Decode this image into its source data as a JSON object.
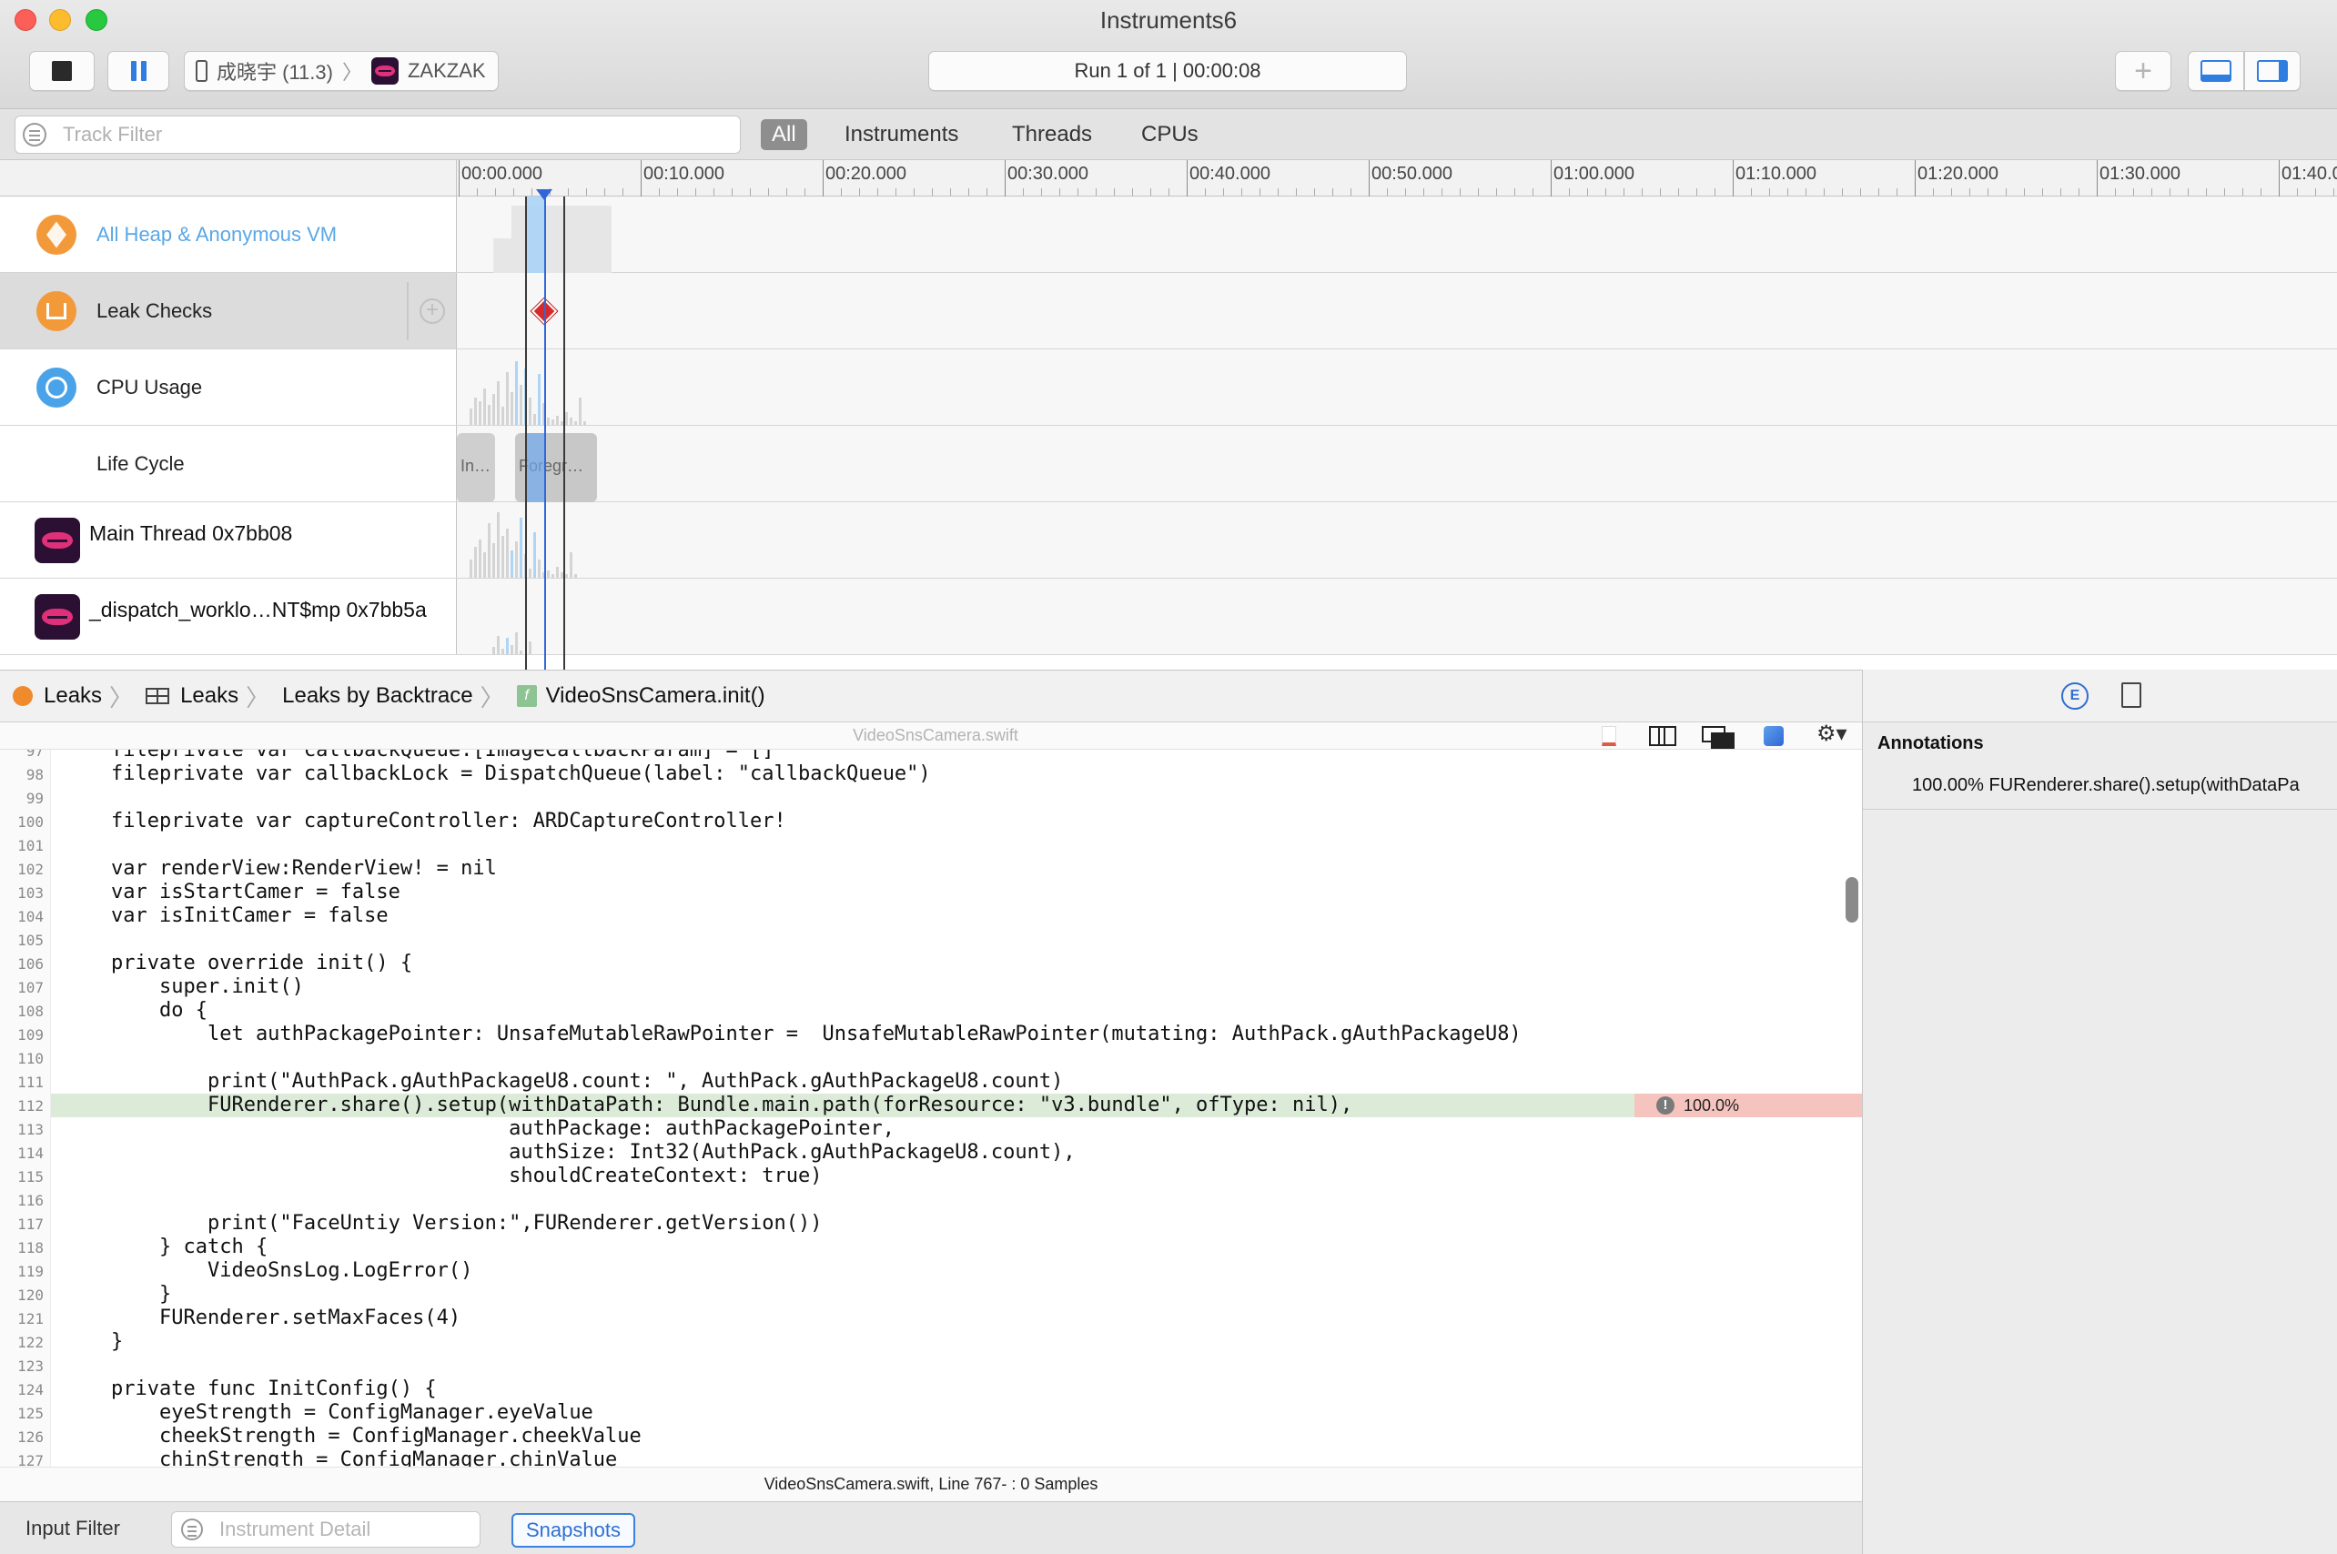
{
  "window": {
    "title": "Instruments6"
  },
  "toolbar": {
    "device_name": "成晓宇 (11.3)",
    "app_name": "ZAKZAK",
    "run_status": "Run 1 of 1  |  00:00:08",
    "add_icon": "plus-icon"
  },
  "filter": {
    "placeholder": "Track Filter",
    "scopes": [
      "All",
      "Instruments",
      "Threads",
      "CPUs"
    ],
    "active_scope": "All"
  },
  "ruler": {
    "ticks": [
      "00:00.000",
      "00:10.000",
      "00:20.000",
      "00:30.000",
      "00:40.000",
      "00:50.000",
      "01:00.000",
      "01:10.000",
      "01:20.000",
      "01:30.000",
      "01:40.0"
    ]
  },
  "tracks": [
    {
      "label": "All Heap & Anonymous VM",
      "icon": "heap-cube-icon",
      "color": "#f29a3a"
    },
    {
      "label": "Leak Checks",
      "icon": "leak-pipe-icon",
      "color": "#f29a3a"
    },
    {
      "label": "CPU Usage",
      "icon": "cpu-ring-icon",
      "color": "#4aa3e8"
    },
    {
      "label": "Life Cycle"
    },
    {
      "label": "Main Thread  0x7bb08",
      "icon": "app-thread-icon"
    },
    {
      "label": "_dispatch_worklo…NT$mp  0x7bb5a",
      "icon": "app-thread-icon"
    }
  ],
  "lifecycle": {
    "seg1": "In…",
    "seg2": "Foregr…"
  },
  "breadcrumb": {
    "items": [
      "Leaks",
      "Leaks",
      "Leaks by Backtrace",
      "VideoSnsCamera.init()"
    ]
  },
  "source": {
    "filename": "VideoSnsCamera.swift",
    "status": "VideoSnsCamera.swift, Line 767- : 0 Samples",
    "hot_line": "112",
    "hot_percent": "100.0%",
    "lines": [
      {
        "n": "97",
        "t": "fileprivate var callbackQueue:[ImageCallbackParam] = []"
      },
      {
        "n": "98",
        "t": "fileprivate var callbackLock = DispatchQueue(label: \"callbackQueue\")"
      },
      {
        "n": "99",
        "t": ""
      },
      {
        "n": "100",
        "t": "fileprivate var captureController: ARDCaptureController!"
      },
      {
        "n": "101",
        "t": ""
      },
      {
        "n": "102",
        "t": "var renderView:RenderView! = nil"
      },
      {
        "n": "103",
        "t": "var isStartCamer = false"
      },
      {
        "n": "104",
        "t": "var isInitCamer = false"
      },
      {
        "n": "105",
        "t": ""
      },
      {
        "n": "106",
        "t": "private override init() {"
      },
      {
        "n": "107",
        "t": "    super.init()"
      },
      {
        "n": "108",
        "t": "    do {"
      },
      {
        "n": "109",
        "t": "        let authPackagePointer: UnsafeMutableRawPointer =  UnsafeMutableRawPointer(mutating: AuthPack.gAuthPackageU8)"
      },
      {
        "n": "110",
        "t": ""
      },
      {
        "n": "111",
        "t": "        print(\"AuthPack.gAuthPackageU8.count: \", AuthPack.gAuthPackageU8.count)"
      },
      {
        "n": "112",
        "t": "        FURenderer.share().setup(withDataPath: Bundle.main.path(forResource: \"v3.bundle\", ofType: nil),"
      },
      {
        "n": "113",
        "t": "                                 authPackage: authPackagePointer,"
      },
      {
        "n": "114",
        "t": "                                 authSize: Int32(AuthPack.gAuthPackageU8.count),"
      },
      {
        "n": "115",
        "t": "                                 shouldCreateContext: true)"
      },
      {
        "n": "116",
        "t": ""
      },
      {
        "n": "117",
        "t": "        print(\"FaceUntiy Version:\",FURenderer.getVersion())"
      },
      {
        "n": "118",
        "t": "    } catch {"
      },
      {
        "n": "119",
        "t": "        VideoSnsLog.LogError()"
      },
      {
        "n": "120",
        "t": "    }"
      },
      {
        "n": "121",
        "t": "    FURenderer.setMaxFaces(4)"
      },
      {
        "n": "122",
        "t": "}"
      },
      {
        "n": "123",
        "t": ""
      },
      {
        "n": "124",
        "t": "private func InitConfig() {"
      },
      {
        "n": "125",
        "t": "    eyeStrength = ConfigManager.eyeValue"
      },
      {
        "n": "126",
        "t": "    cheekStrength = ConfigManager.cheekValue"
      },
      {
        "n": "127",
        "t": "    chinStrength = ConfigManager.chinValue"
      }
    ]
  },
  "bottom": {
    "input_filter_label": "Input Filter",
    "detail_placeholder": "Instrument Detail",
    "snapshots_label": "Snapshots"
  },
  "inspector": {
    "title": "Annotations",
    "row": "100.00% FURenderer.share().setup(withDataPa"
  },
  "colors": {
    "accent": "#2f6fd1",
    "heap_track": "#5aa7e6",
    "hot_line_bg": "#dcebd8",
    "hot_cell_bg": "#f6c4be",
    "leak_marker": "#d62a2a"
  }
}
